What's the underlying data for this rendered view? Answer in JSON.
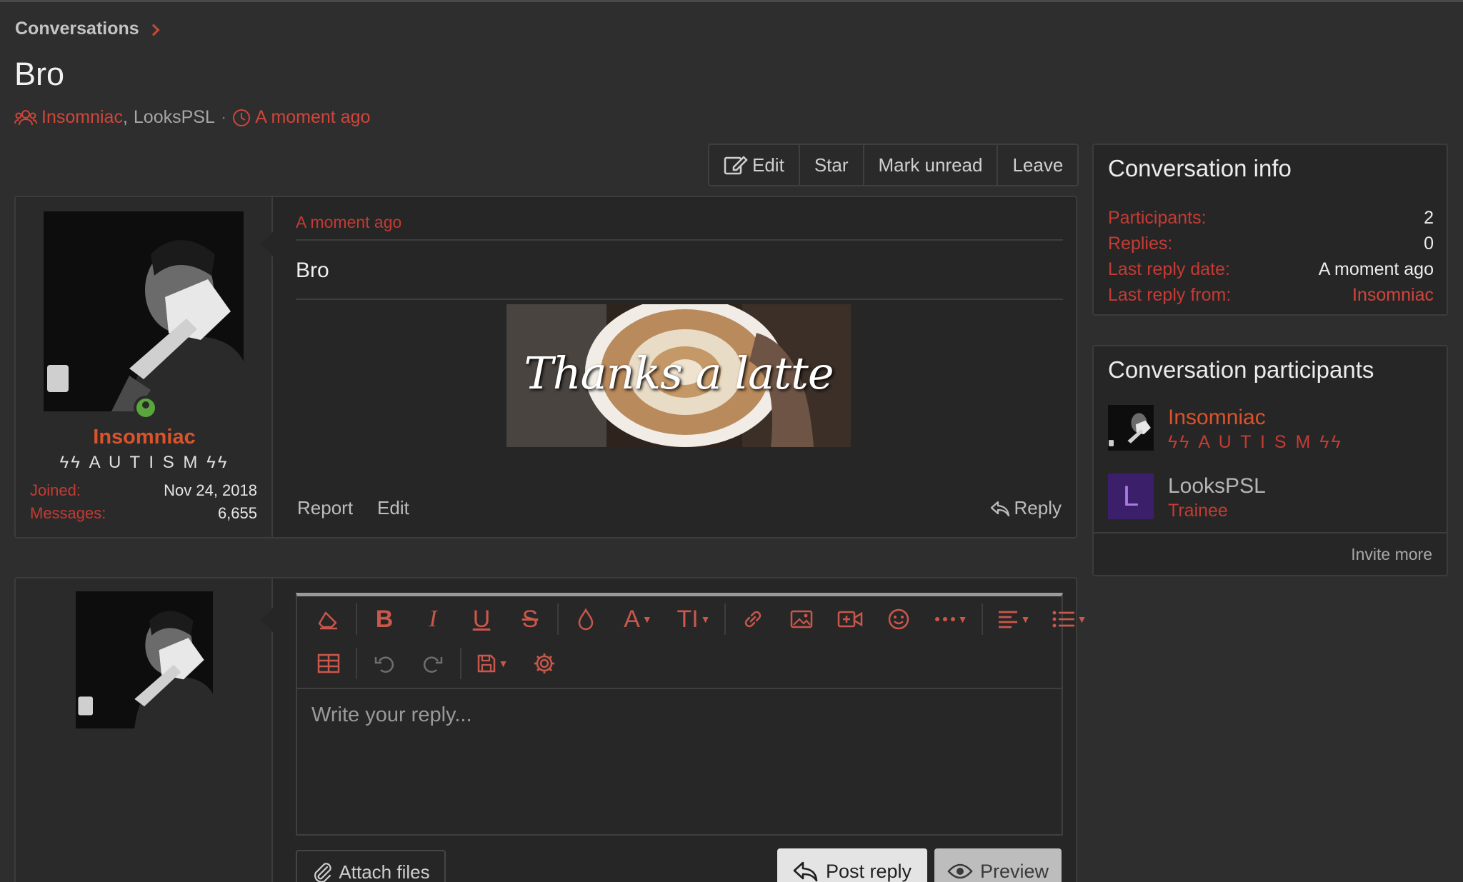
{
  "breadcrumb": {
    "label": "Conversations"
  },
  "conversation": {
    "title": "Bro",
    "participant_1": "Insomniac",
    "participant_sep": ",",
    "participant_2": "LooksPSL",
    "time": "A moment ago"
  },
  "actions": {
    "edit": "Edit",
    "star": "Star",
    "mark_unread": "Mark unread",
    "leave": "Leave"
  },
  "message": {
    "author": {
      "name": "Insomniac",
      "title": "ϟϟ A U T I S M ϟϟ",
      "joined_label": "Joined:",
      "joined_value": "Nov 24, 2018",
      "messages_label": "Messages:",
      "messages_value": "6,655"
    },
    "date": "A moment ago",
    "text": "Bro",
    "image_caption": "Thanks a latte",
    "report": "Report",
    "edit": "Edit",
    "reply": "Reply"
  },
  "reply_form": {
    "placeholder": "Write your reply...",
    "attach": "Attach files",
    "post": "Post reply",
    "preview": "Preview",
    "toolbar": {
      "bold": "B",
      "italic": "I",
      "underline": "U",
      "strike": "S",
      "font": "A",
      "size": "TI"
    }
  },
  "sidebar": {
    "info": {
      "title": "Conversation info",
      "rows": [
        {
          "label": "Participants:",
          "value": "2"
        },
        {
          "label": "Replies:",
          "value": "0"
        },
        {
          "label": "Last reply date:",
          "value": "A moment ago"
        },
        {
          "label": "Last reply from:",
          "value": "Insomniac"
        }
      ]
    },
    "participants": {
      "title": "Conversation participants",
      "items": [
        {
          "name": "Insomniac",
          "subtitle": "ϟϟ A U T I S M ϟϟ"
        },
        {
          "name": "LooksPSL",
          "subtitle": "Trainee",
          "avatar_letter": "L"
        }
      ],
      "invite": "Invite more"
    }
  },
  "colors": {
    "accent": "#d0453a",
    "background": "#2e2e2e",
    "panel": "#262626"
  }
}
